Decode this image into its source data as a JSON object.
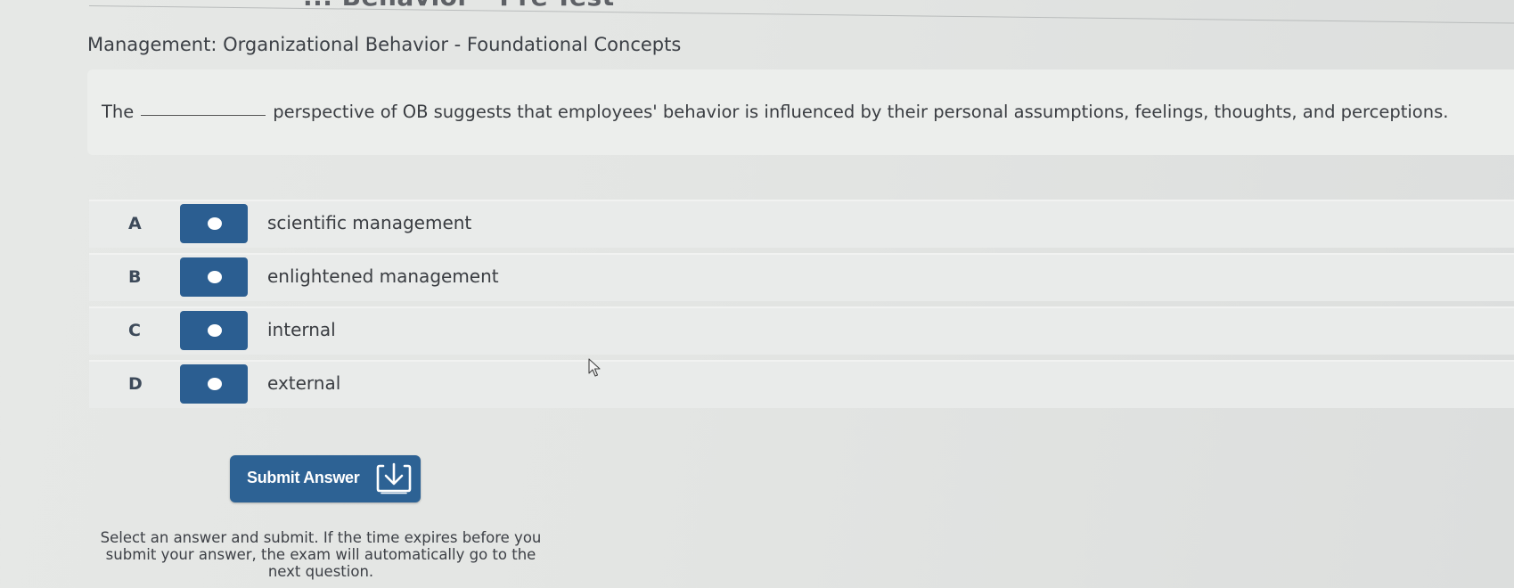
{
  "page": {
    "top_title": "... Behavior - Pre-Test",
    "heading": "Management: Organizational Behavior - Foundational Concepts"
  },
  "question": {
    "prefix": "The",
    "suffix": "perspective of OB suggests that employees' behavior is influenced by their personal assumptions, feelings, thoughts, and perceptions."
  },
  "options": [
    {
      "letter": "A",
      "text": "scientific management"
    },
    {
      "letter": "B",
      "text": "enlightened management"
    },
    {
      "letter": "C",
      "text": "internal"
    },
    {
      "letter": "D",
      "text": "external"
    }
  ],
  "submit": {
    "label": "Submit Answer",
    "icon": "submit-arrow-icon"
  },
  "instructions": "Select an answer and submit. If the time expires before you submit your answer, the exam will automatically go to the next question.",
  "colors": {
    "accent": "#2b5e91",
    "submit": "#2d6294",
    "background": "#e4e6e4"
  }
}
